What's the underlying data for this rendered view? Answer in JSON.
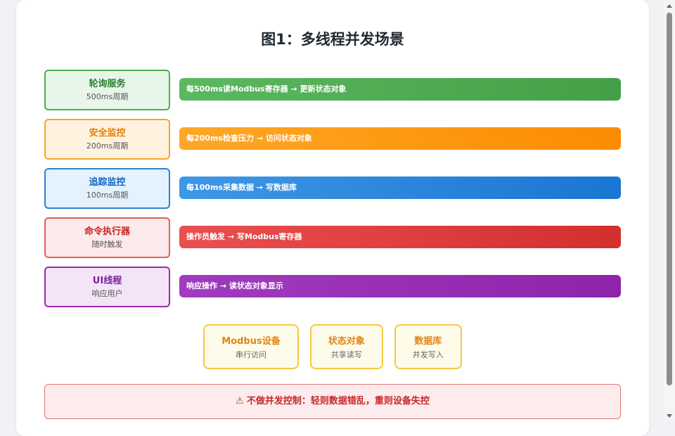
{
  "title": "图1：多线程并发场景",
  "threads": [
    {
      "name": "轮询服务",
      "sub": "500ms周期",
      "desc": "每500ms读Modbus寄存器 → 更新状态对象",
      "border": "#4caf50",
      "fill": "#e8f5e9",
      "text": "#2e7d32",
      "bar_from": "#5cb860",
      "bar_to": "#43a047"
    },
    {
      "name": "安全监控",
      "sub": "200ms周期",
      "desc": "每200ms检查压力 → 访问状态对象",
      "border": "#f5a623",
      "fill": "#fff3e0",
      "text": "#e67e00",
      "bar_from": "#ffa726",
      "bar_to": "#fb8c00"
    },
    {
      "name": "追踪监控",
      "sub": "100ms周期",
      "desc": "每100ms采集数据 → 写数据库",
      "border": "#2f80d1",
      "fill": "#e3f2fd",
      "text": "#1565c0",
      "bar_from": "#3f97e6",
      "bar_to": "#1976d2"
    },
    {
      "name": "命令执行器",
      "sub": "随时触发",
      "desc": "操作员触发 → 写Modbus寄存器",
      "border": "#e35d5d",
      "fill": "#fdeaea",
      "text": "#c62828",
      "bar_from": "#ea4f4f",
      "bar_to": "#d32f2f"
    },
    {
      "name": "UI线程",
      "sub": "响应用户",
      "desc": "响应操作 → 读状态对象显示",
      "border": "#9c27b0",
      "fill": "#f3e5f5",
      "text": "#7b1fa2",
      "bar_from": "#a03bbf",
      "bar_to": "#8e24aa"
    }
  ],
  "resources": [
    {
      "name": "Modbus设备",
      "sub": "串行访问"
    },
    {
      "name": "状态对象",
      "sub": "共享读写"
    },
    {
      "name": "数据库",
      "sub": "并发写入"
    }
  ],
  "warning": {
    "icon": "⚠",
    "text": "不做并发控制：轻则数据错乱，重则设备失控"
  }
}
